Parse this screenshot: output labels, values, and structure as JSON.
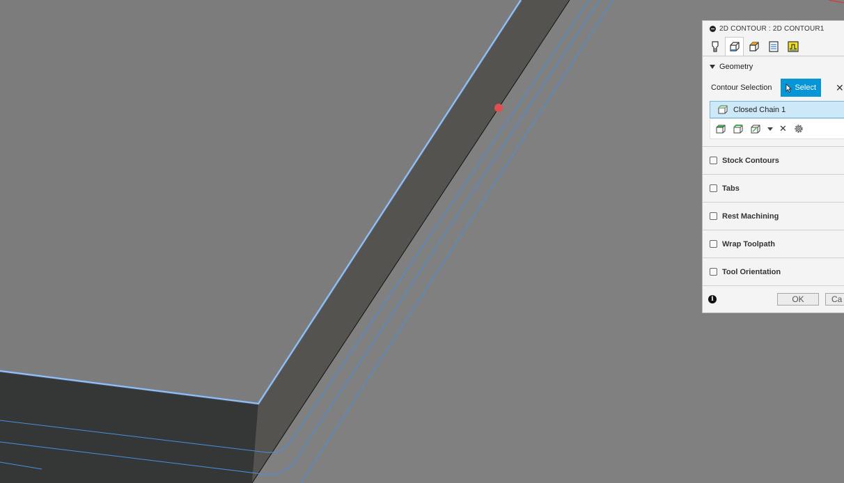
{
  "panel": {
    "title": "2D CONTOUR : 2D CONTOUR1",
    "tabs": [
      {
        "icon": "tool-icon",
        "active": false
      },
      {
        "icon": "geometry-icon",
        "active": true
      },
      {
        "icon": "heights-icon",
        "active": false
      },
      {
        "icon": "passes-icon",
        "active": false
      },
      {
        "icon": "linking-icon",
        "active": false
      }
    ],
    "geometry": {
      "header": "Geometry",
      "contour_selection_label": "Contour Selection",
      "select_label": "Select",
      "chain_label": "Closed Chain 1"
    },
    "sections": [
      "Stock Contours",
      "Tabs",
      "Rest Machining",
      "Wrap Toolpath",
      "Tool Orientation"
    ],
    "ok_label": "OK",
    "cancel_label": "Ca"
  },
  "colors": {
    "viewport_bg": "#808080",
    "top_face": "#7c7c7c",
    "side_face": "#55534f",
    "front_face": "#353636",
    "edge_highlight": "#a8cdf8",
    "toolpath": "#4a8fe0",
    "accent": "#0696d7",
    "marker": "#e05050"
  }
}
